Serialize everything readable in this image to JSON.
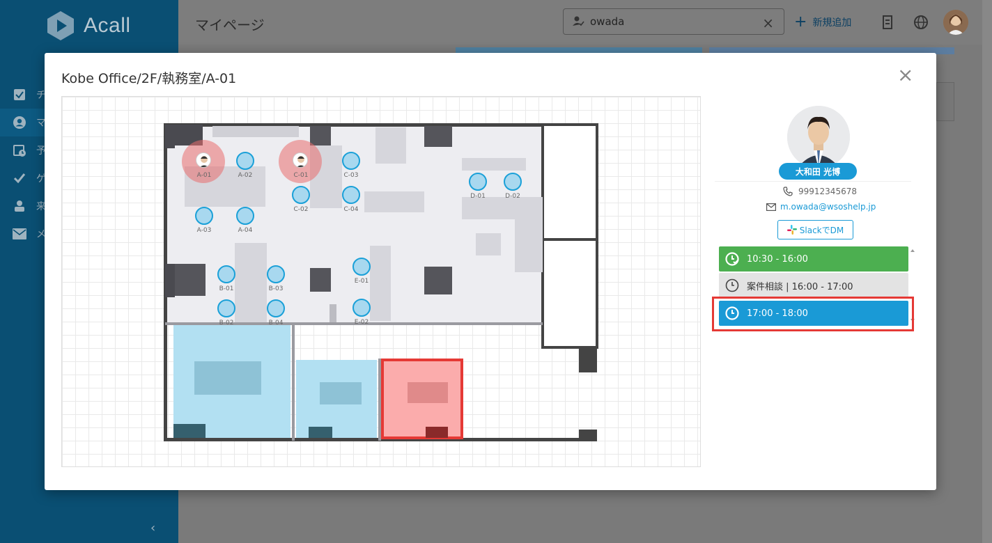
{
  "app": {
    "logo_text": "Acall"
  },
  "sidebar": {
    "items": [
      {
        "label": "チ",
        "icon": "checkbox-icon"
      },
      {
        "label": "マ",
        "icon": "account-circle-icon",
        "active": true
      },
      {
        "label": "予",
        "icon": "calendar-clock-icon"
      },
      {
        "label": "ゲ",
        "icon": "checkmark-icon"
      },
      {
        "label": "来",
        "icon": "people-icon"
      },
      {
        "label": "メ",
        "icon": "mail-icon"
      }
    ],
    "collapse_label": "‹"
  },
  "header": {
    "page_title": "マイページ",
    "search_value": "owada",
    "add_new_label": "新規追加"
  },
  "modal": {
    "title": "Kobe Office/2F/執務室/A-01",
    "close_label": "×"
  },
  "floor_map": {
    "occupied_seats": [
      {
        "label": "A-01"
      },
      {
        "label": "C-01"
      }
    ],
    "seats": [
      {
        "label": "A-02"
      },
      {
        "label": "A-03"
      },
      {
        "label": "A-04"
      },
      {
        "label": "C-02"
      },
      {
        "label": "C-03"
      },
      {
        "label": "C-04"
      },
      {
        "label": "D-01"
      },
      {
        "label": "D-02"
      },
      {
        "label": "B-01"
      },
      {
        "label": "B-02"
      },
      {
        "label": "B-03"
      },
      {
        "label": "B-04"
      },
      {
        "label": "E-01"
      },
      {
        "label": "E-02"
      }
    ]
  },
  "profile": {
    "name": "大和田 光博",
    "phone": "99912345678",
    "email": "m.owada@wsoshelp.jp",
    "slack_button": "SlackでDM"
  },
  "schedule": [
    {
      "label": "10:30 - 16:00",
      "color": "#4caf50"
    },
    {
      "label": "案件相談 | 16:00 - 17:00",
      "color": "#e3e3e3"
    },
    {
      "label": "17:00 - 18:00",
      "color": "#1a9ad6",
      "selected": true
    }
  ],
  "colors": {
    "accent": "#1a9ad6",
    "highlight": "#e53935",
    "sidebar": "#0a4f73"
  }
}
